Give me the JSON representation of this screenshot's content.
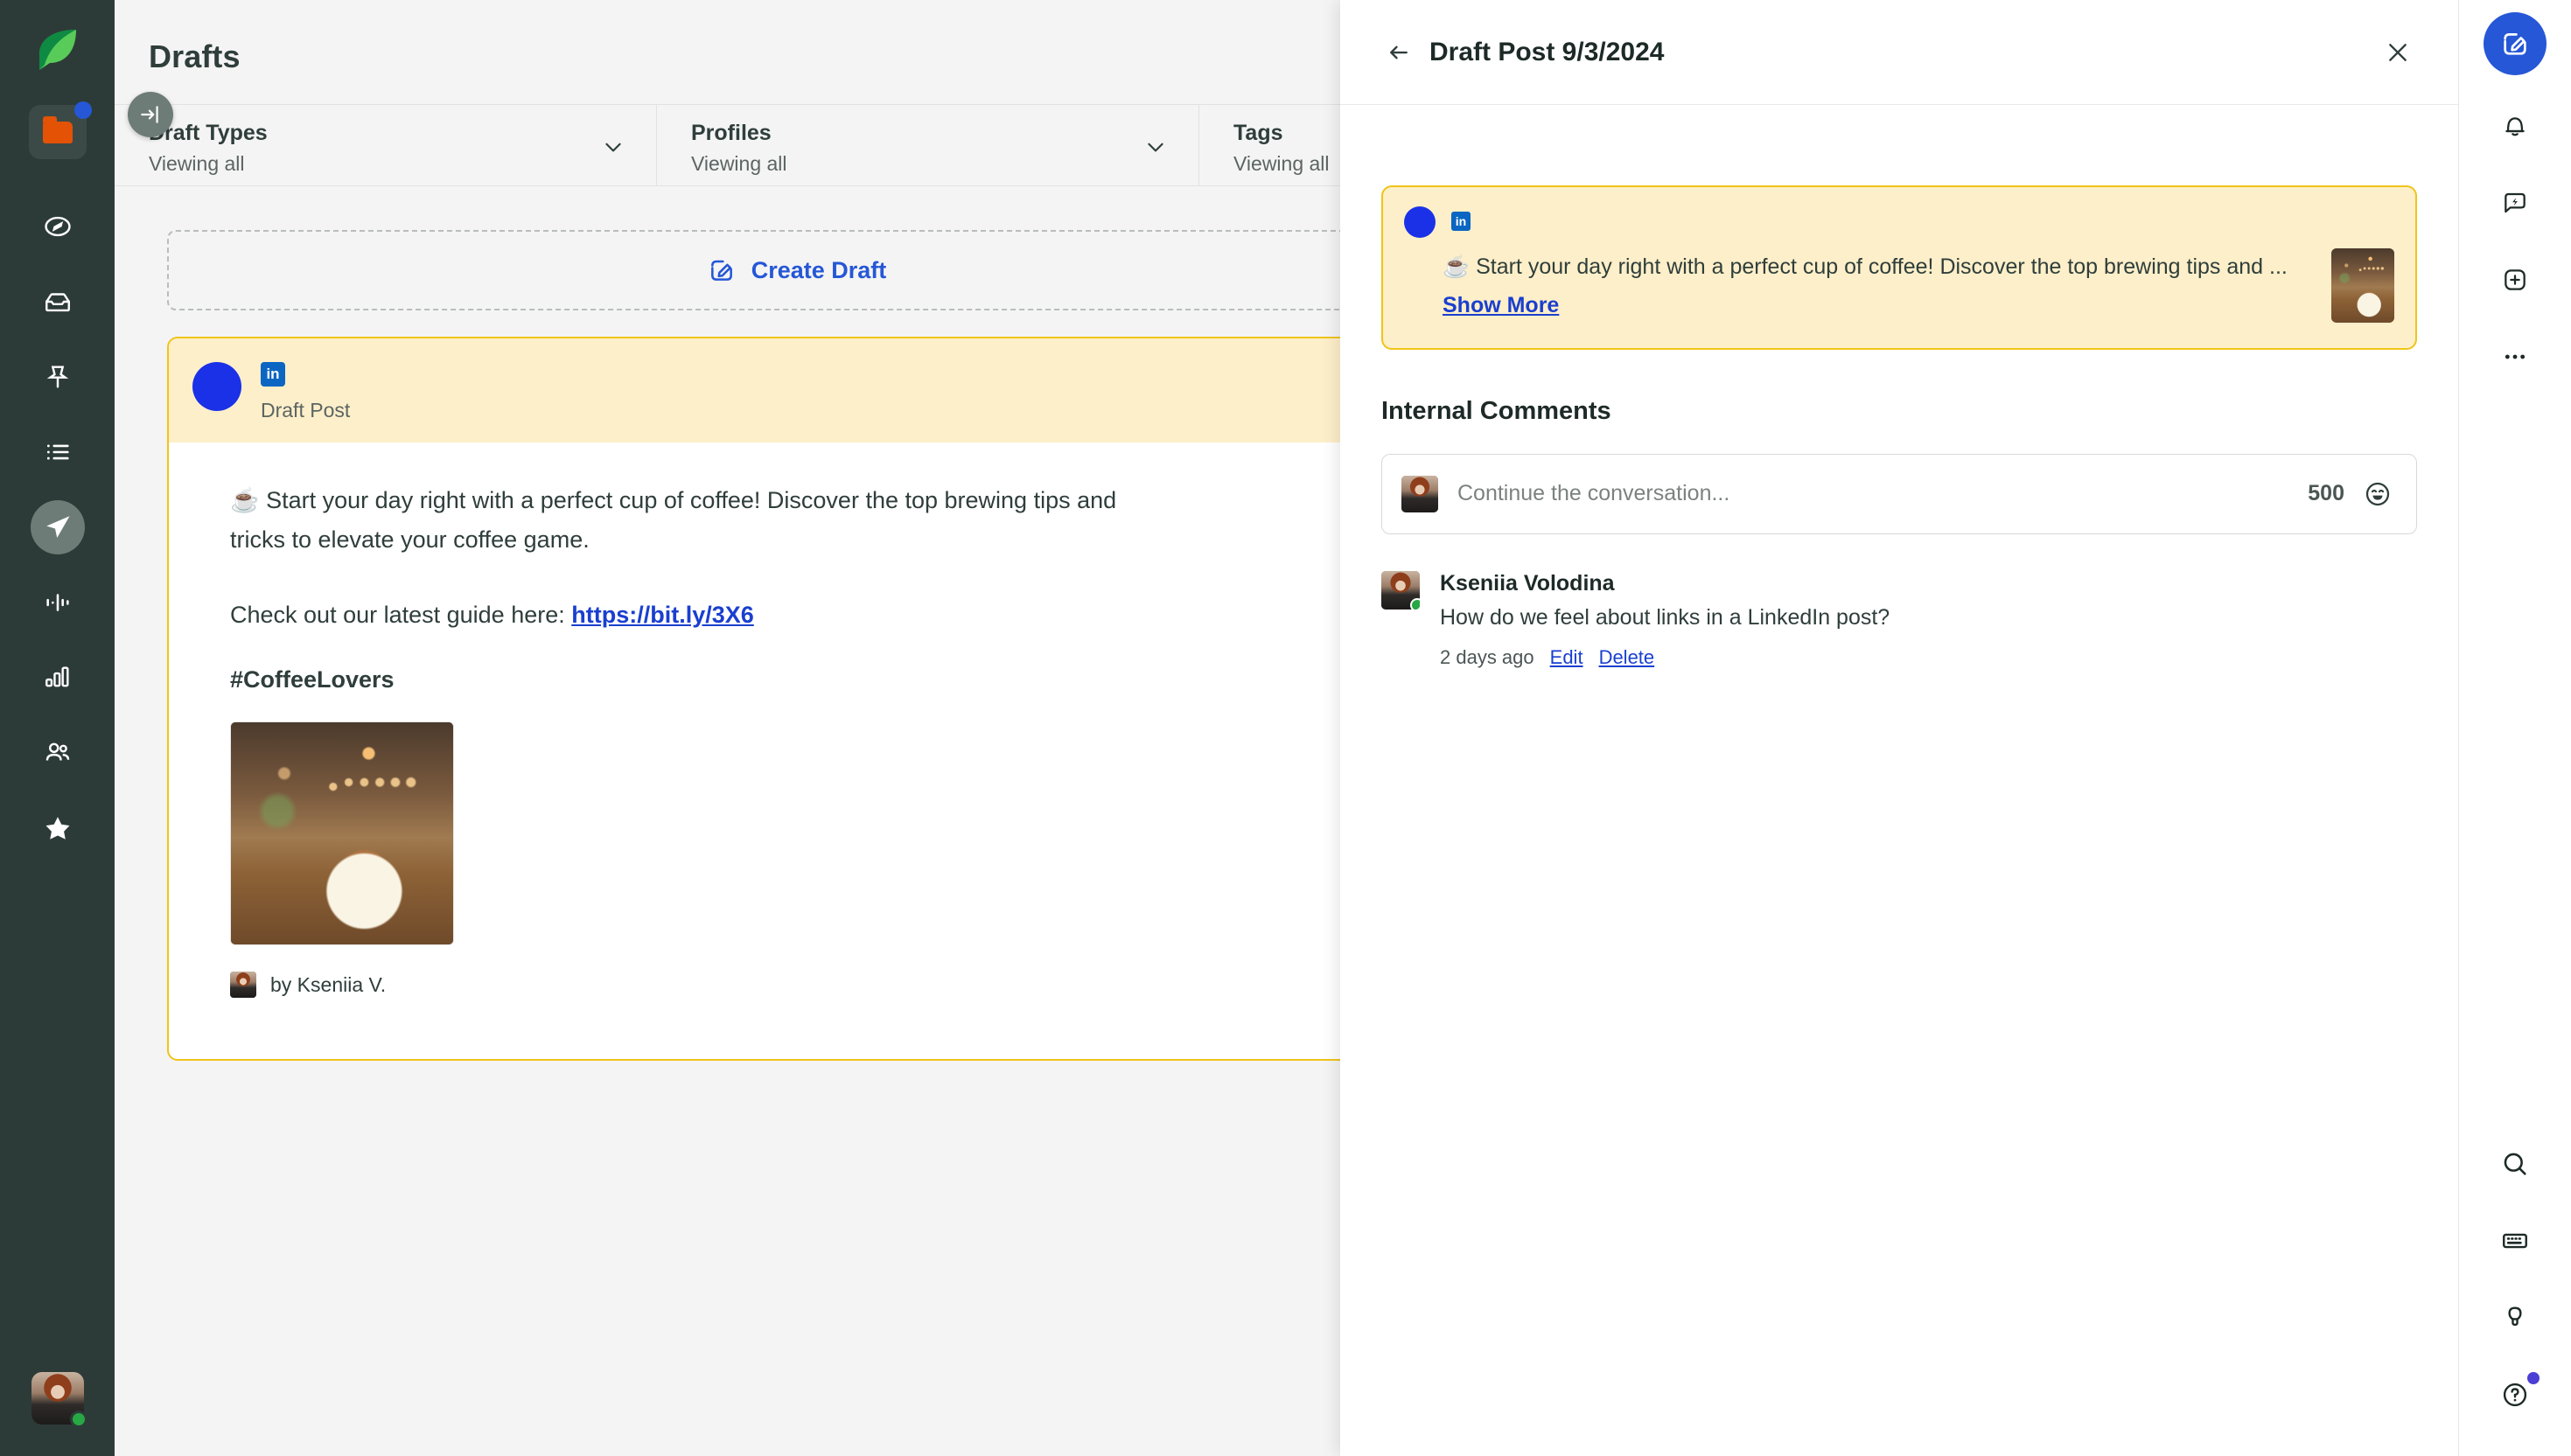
{
  "left_rail": {
    "logo_name": "sprout-leaf-logo",
    "items": [
      {
        "name": "folder-icon",
        "badge": true
      },
      {
        "name": "compass-icon"
      },
      {
        "name": "inbox-icon"
      },
      {
        "name": "pin-icon"
      },
      {
        "name": "list-icon"
      },
      {
        "name": "publishing-paper-plane-icon",
        "active": true
      },
      {
        "name": "listening-waveform-icon"
      },
      {
        "name": "reports-bar-chart-icon"
      },
      {
        "name": "employee-advocacy-people-icon"
      },
      {
        "name": "premium-star-icon"
      }
    ],
    "avatar_status": "online"
  },
  "collapse_button": {
    "label": "expand-sidebar"
  },
  "main": {
    "title": "Drafts",
    "filters": [
      {
        "label": "Draft Types",
        "value": "Viewing all"
      },
      {
        "label": "Profiles",
        "value": "Viewing all"
      },
      {
        "label": "Tags",
        "value": "Viewing all"
      }
    ],
    "create_draft_label": "Create Draft",
    "post": {
      "network": "in",
      "type_label": "Draft Post",
      "text_line1": "☕ Start your day right with a perfect cup of coffee! Discover the top brewing tips and ",
      "text_line2": "tricks to elevate your coffee game.",
      "link_prefix": "Check out our latest guide here: ",
      "link_text": "https://bit.ly/3X6",
      "hashtag": "#CoffeeLovers",
      "author_byline": "by Kseniia V."
    }
  },
  "detail_panel": {
    "title": "Draft Post 9/3/2024",
    "back_icon": "arrow-left-icon",
    "close_icon": "close-icon",
    "mini_post": {
      "network": "in",
      "text": "☕ Start your day right with a perfect cup of coffee! Discover the top brewing tips and ... ",
      "show_more_label": "Show More"
    },
    "comments_section_title": "Internal Comments",
    "composer": {
      "placeholder": "Continue the conversation...",
      "char_count": "500",
      "emoji_icon": "emoji-smile-icon"
    },
    "comments": [
      {
        "author": "Kseniia Volodina",
        "status": "online",
        "text": "How do we feel about links in a LinkedIn post?",
        "timestamp": "2 days ago",
        "edit_label": "Edit",
        "delete_label": "Delete"
      }
    ]
  },
  "right_rail": {
    "compose_icon": "compose-pencil-icon",
    "items": [
      {
        "name": "bell-notifications-icon"
      },
      {
        "name": "bolt-message-icon"
      },
      {
        "name": "add-plus-icon"
      },
      {
        "name": "more-ellipsis-icon"
      }
    ],
    "bottom_items": [
      {
        "name": "search-icon"
      },
      {
        "name": "keyboard-shortcuts-icon"
      },
      {
        "name": "lightbulb-ideas-icon"
      },
      {
        "name": "help-question-icon",
        "badge": true
      }
    ]
  },
  "colors": {
    "rail_bg": "#2d3b38",
    "accent_blue": "#2557d6",
    "link_blue": "#1a3fcf",
    "highlight_yellow_border": "#f0c419",
    "highlight_yellow_bg": "#fdefc9",
    "linkedin_blue": "#0a66c2",
    "online_green": "#28a745",
    "orange_folder": "#e35205"
  }
}
